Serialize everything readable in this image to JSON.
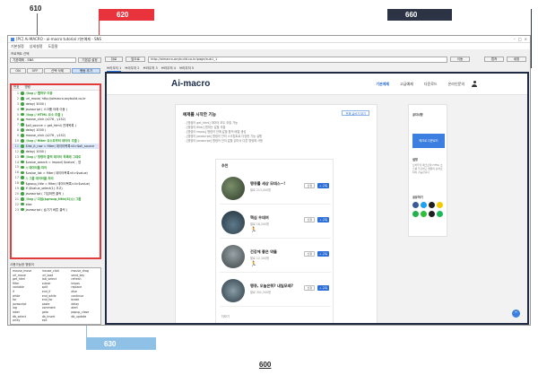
{
  "figure": {
    "refs": {
      "left_panel": "610",
      "script_area": "620",
      "browser_area": "660",
      "command_area": "630",
      "figure_number": "600"
    }
  },
  "window": {
    "title": "[PC] Ai-MACRO - ai-macro tutorial 기본예제 - SNS",
    "controls": [
      "–",
      "□",
      "×"
    ],
    "menu": [
      "기본설정",
      "상세설정",
      "도움말"
    ]
  },
  "left_panel": {
    "script_label": "프로젝트 선택",
    "script_combo": "기본예제 - SNS",
    "script_save_button": "기본값 설정",
    "toolbar": [
      "ON",
      "OFF",
      "선택 삭제",
      "행동 추가"
    ],
    "list_headers": [
      "번호",
      "명령"
    ],
    "lines": [
      {
        "n": "1",
        "text": "//log // 웹하우 이동",
        "type": "comment"
      },
      {
        "n": "2",
        "text": "url_move( http://aimacro.anybuild.co.kr",
        "type": "normal"
      },
      {
        "n": "3",
        "text": "delay( 3000 )",
        "type": "normal"
      },
      {
        "n": "4",
        "text": "javascript ( 스크롤 아래 이동 )",
        "type": "normal"
      },
      {
        "n": "5",
        "text": "//log // HTML 요소 추출 )",
        "type": "comment"
      },
      {
        "n": "6",
        "text": "mouse_click (x276 , y152)",
        "type": "normal"
      },
      {
        "n": "7",
        "text": "$all_source = get_html( 전체목록 )",
        "type": "normal"
      },
      {
        "n": "8",
        "text": "delay( 1000 )",
        "type": "normal"
      },
      {
        "n": "9",
        "text": "mouse_click (x276 , y152)",
        "type": "normal"
      },
      {
        "n": "10",
        "text": "//log // filter 요소로부터 데이터 추출 )",
        "type": "comment"
      },
      {
        "n": "11",
        "text": "$list_it_row = filter( 데이터목록<li>$all_source",
        "type": "normal"
      },
      {
        "n": "12",
        "text": "delay( 1000 )",
        "type": "normal"
      },
      {
        "n": "13",
        "text": "//log // 명령어 출력 데이터 목록에 그대로",
        "type": "comment"
      },
      {
        "n": "14",
        "text": "$value_search = impod( $value( , 영",
        "type": "normal"
      },
      {
        "n": "15",
        "text": "// 데이터를 처리 ",
        "type": "comment"
      },
      {
        "n": "16",
        "text": "$value_list = filter( 데이터목록<li>$value)",
        "type": "normal"
      },
      {
        "n": "17",
        "text": "// 그룹 데이터를 처리",
        "type": "comment"
      },
      {
        "n": "18",
        "text": "$group_title = filter( 데이터목록<li>$value)",
        "type": "normal"
      },
      {
        "n": "19",
        "text": "if ($value_select(1) 크고)",
        "type": "normal"
      },
      {
        "n": "20",
        "text": "javascript ( 기입하면 클릭 )",
        "type": "normal"
      },
      {
        "n": "21",
        "text": "//log // 다음($group_title(3)))) 그룹",
        "type": "comment"
      },
      {
        "n": "22",
        "text": "else",
        "type": "normal"
      },
      {
        "n": "23",
        "text": "javascript ( 숨기기 버튼 클릭 )",
        "type": "normal"
      }
    ],
    "command_title": "사용가능한 명령어",
    "commands": [
      "mouse_move",
      "mouse_click",
      "mouse_drag",
      "url_move",
      "url_load",
      "send_key",
      "get_html",
      "tab_select",
      "refresh",
      "filter",
      "substr",
      "impos",
      "variable",
      "split",
      "replace",
      "if",
      "end_if",
      "else",
      "while",
      "end_while",
      "continue",
      "for",
      "end_for",
      "break",
      "javascript",
      "paste",
      "delay",
      "log",
      "comment",
      "alert",
      "label",
      "goto",
      "popup_close",
      "db_select",
      "db_insert",
      "db_update",
      "array",
      "exit",
      ""
    ]
  },
  "browser": {
    "nav_buttons": [
      "뒤로",
      "앞으로"
    ],
    "url": "http://aimacro.anybuild.co.kr/page/sub1_1",
    "go_button": "이동",
    "right_buttons": [
      "캡쳐",
      "새창"
    ],
    "tabs": [
      "브라우저 1",
      "브라우저 2",
      "브라우저 3",
      "브라우저 4",
      "브라우저 5"
    ]
  },
  "site": {
    "logo": "Ai-macro",
    "nav": [
      "기본예제",
      "고급예제",
      "다운로드",
      "온라인문의"
    ],
    "notice": {
      "title": "예제를 시작한 기능",
      "button": "전체 글쓰기 보기",
      "items": [
        "- [명령어 get_html] 데이터 모두 추출 가능",
        "- [명령어 filter] 원하는 값을 추출",
        "- [명령어 impos] 명령어 안에 값을 합쳐 배열 생성",
        "- [명령어 javascript] 명령어 안의 스크립트로 다양한 기능 실행",
        "- [명령어 javascript] 명령어 안의 값을 읽어서 다른 명령에 사용"
      ]
    },
    "recommend": {
      "title": "추천",
      "items": [
        {
          "name": "땡큐를 세상 모데스~!",
          "sub": "팔로 213,000명",
          "follow": "+ 구독",
          "other": "신청"
        },
        {
          "name": "핵심 우데여",
          "sub": "팔로 18,200명",
          "follow": "+ 구독",
          "other": "신청"
        },
        {
          "name": "건강에 좋은 약들",
          "sub": "팔로 12,100명",
          "follow": "+ 구독",
          "other": "신청"
        },
        {
          "name": "땡큐, 오늘은뭐? 내일모레?",
          "sub": "팔로 301,200명",
          "follow": "+ 구독",
          "other": "신청"
        }
      ],
      "footer": "더보기"
    },
    "side": {
      "title1": "공지사항",
      "button": "메크로 다운로드",
      "title2": "설명",
      "desc": "브라우저 매크로의 HTML 소스를 추출하고 명령어 순서로 처리 가능합니다",
      "title3": "공유하기"
    },
    "fab": "^"
  },
  "colors": {
    "script_border": "#e33b3b",
    "browser_border": "#1f2a44",
    "tab_620": "#e8323c",
    "tab_660": "#2b3345",
    "tab_630": "#8fc1e6",
    "accent": "#2d6fd6"
  }
}
